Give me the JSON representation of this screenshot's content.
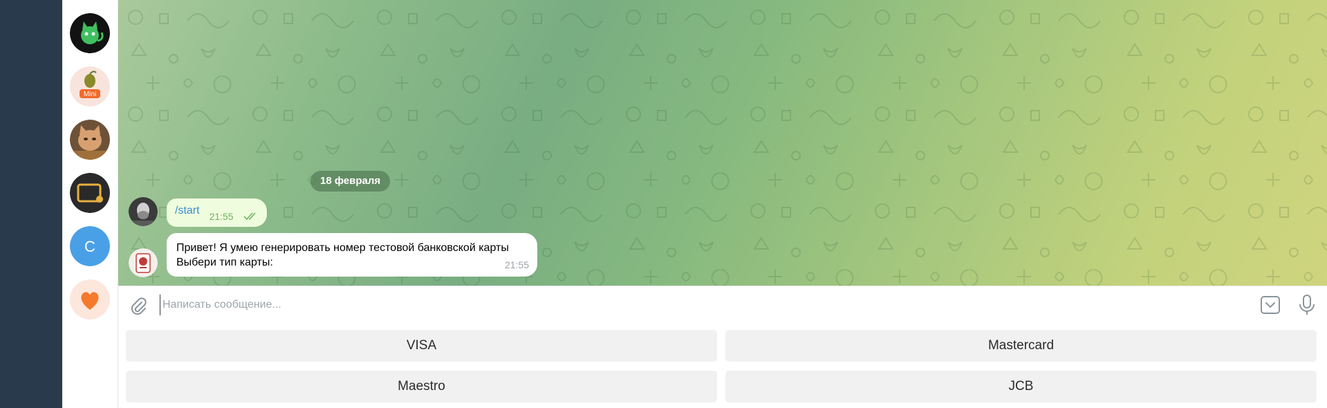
{
  "sidebar": {
    "chats": [
      {
        "name": "cat-bot",
        "color": "#111111"
      },
      {
        "name": "mini-app",
        "badge": "Mini",
        "color": "#f7e6df"
      },
      {
        "name": "cat-photo",
        "color": "#7a5a40"
      },
      {
        "name": "tv-bot",
        "color": "#2a2a2a"
      },
      {
        "name": "contact-c",
        "letter": "C",
        "color": "#4aa0e6"
      },
      {
        "name": "heart-app",
        "color": "#fde8e0"
      }
    ]
  },
  "chat": {
    "date": "18 февраля",
    "messages": [
      {
        "direction": "out",
        "text": "/start",
        "time": "21:55",
        "read": true
      },
      {
        "direction": "in",
        "lines": [
          "Привет! Я умею генерировать номер тестовой банковской карты",
          "Выбери тип карты:"
        ],
        "time": "21:55"
      }
    ]
  },
  "composer": {
    "placeholder": "Написать сообщение..."
  },
  "keyboard": {
    "rows": [
      [
        "VISA",
        "Mastercard"
      ],
      [
        "Maestro",
        "JCB"
      ]
    ]
  },
  "colors": {
    "accent": "#3a8ecf",
    "outgoing_bubble": "#effdde",
    "check": "#6fb25f",
    "dark_panel": "#293a4c"
  }
}
